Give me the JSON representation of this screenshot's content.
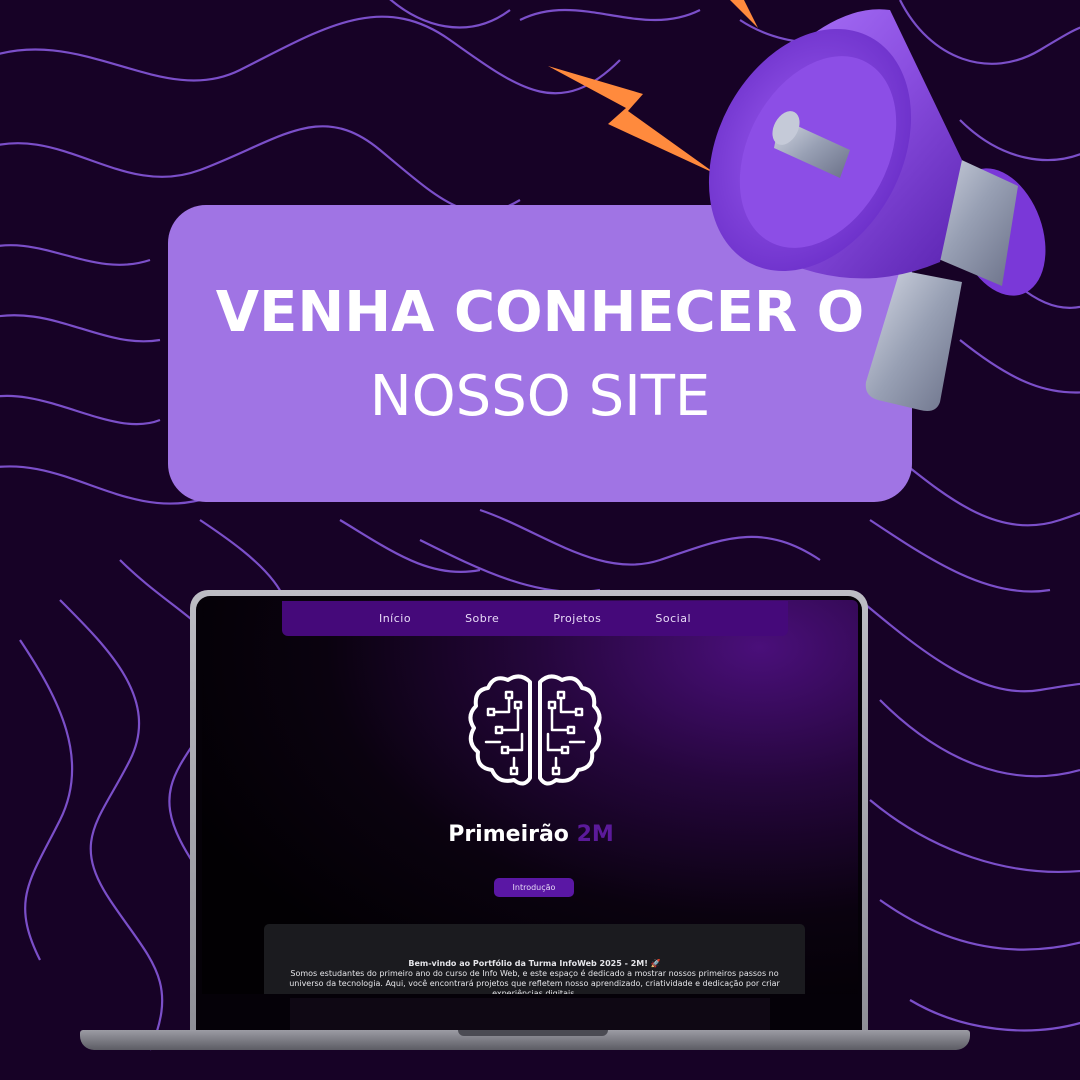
{
  "banner": {
    "line1": "VENHA CONHECER O",
    "line2": "NOSSO SITE"
  },
  "site": {
    "nav": [
      {
        "label": "Início"
      },
      {
        "label": "Sobre"
      },
      {
        "label": "Projetos"
      },
      {
        "label": "Social"
      }
    ],
    "title_main": "Primeirão",
    "title_accent": "2M",
    "intro_button": "Introdução",
    "card": {
      "title": "Bem-vindo ao Portfólio da Turma InfoWeb 2025 - 2M! 🚀",
      "body": "Somos estudantes do primeiro ano do curso de Info Web, e este espaço é dedicado a mostrar nossos primeiros passos no universo da tecnologia. Aqui, você encontrará projetos que refletem nosso aprendizado, criatividade e dedicação por criar experiências digitais."
    }
  },
  "icons": {
    "megaphone": "megaphone-icon",
    "bolt": "lightning-bolt-icon",
    "brain": "circuit-brain-icon"
  },
  "colors": {
    "background": "#170226",
    "contour": "#7b4fc9",
    "banner": "#a074e4",
    "bolt": "#ff8a3d",
    "megaphone": "#8a4ee0",
    "nav": "#45097a",
    "accent": "#5b1a9a",
    "button": "#5a17a4"
  }
}
